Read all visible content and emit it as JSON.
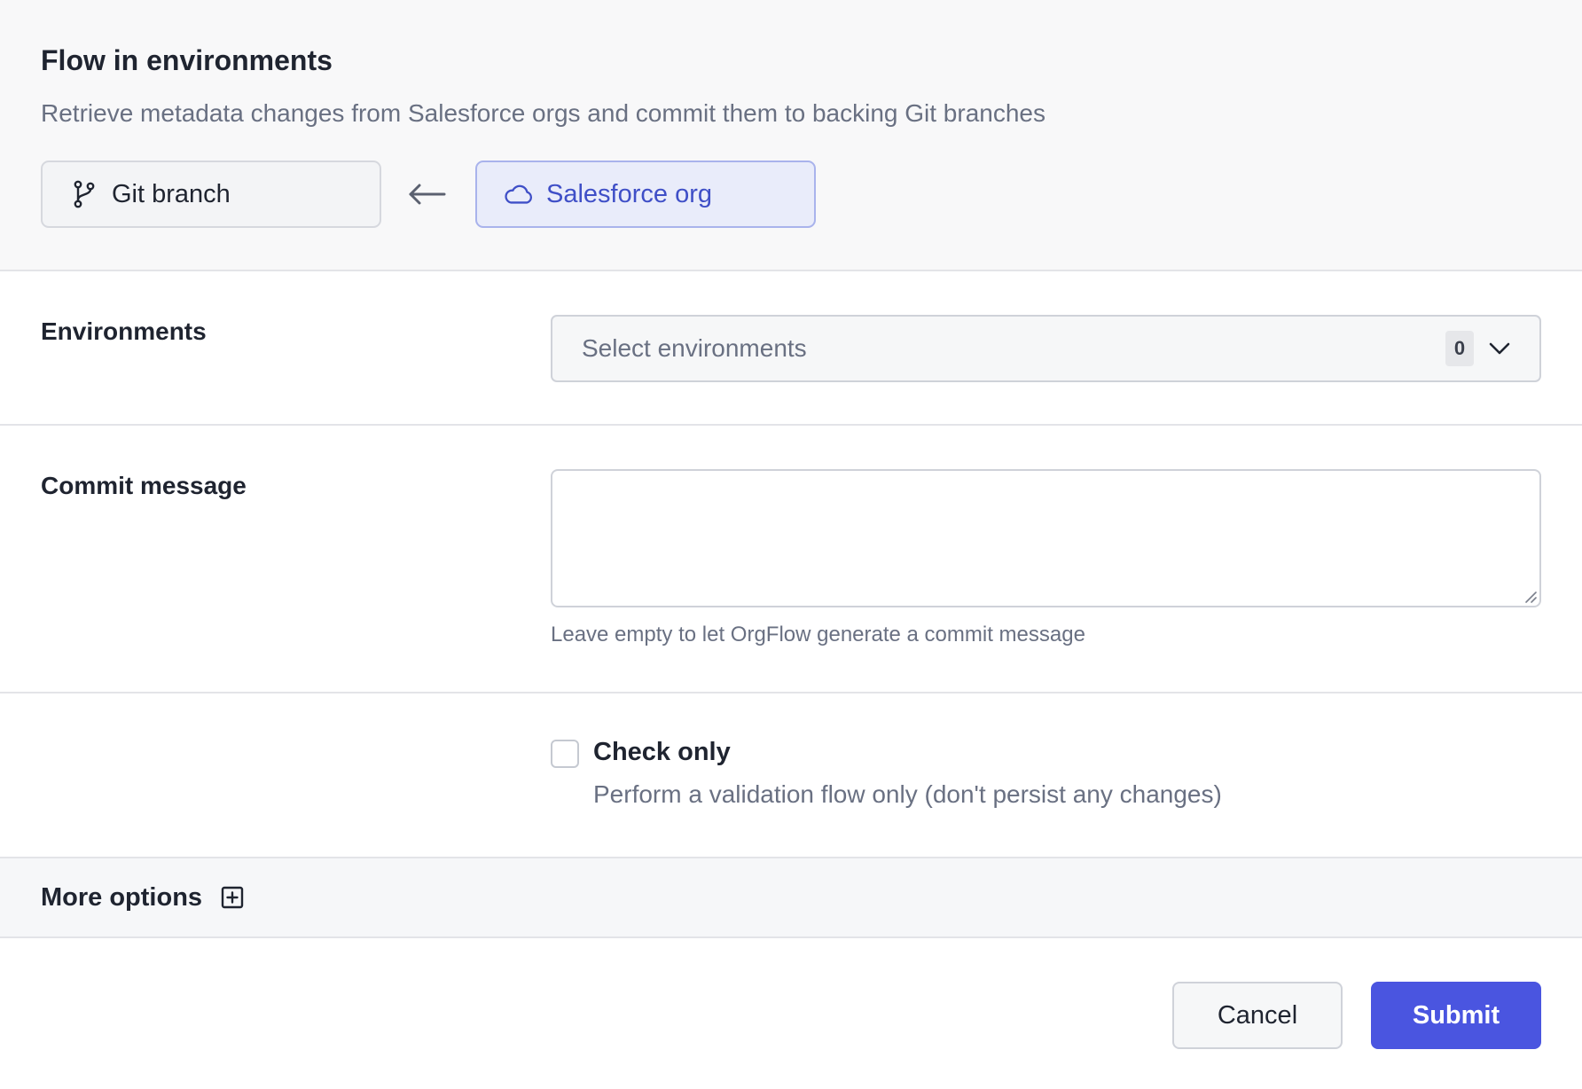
{
  "header": {
    "title": "Flow in environments",
    "subtitle": "Retrieve metadata changes from Salesforce orgs and commit them to backing Git branches",
    "direction": {
      "target_label": "Git branch",
      "target_icon": "git-branch-icon",
      "source_label": "Salesforce org",
      "source_icon": "cloud-icon",
      "arrow_icon": "arrow-left-icon"
    }
  },
  "environments": {
    "label": "Environments",
    "placeholder": "Select environments",
    "count": "0",
    "icon": "chevron-down-icon"
  },
  "commit": {
    "label": "Commit message",
    "value": "",
    "hint": "Leave empty to let OrgFlow generate a commit message"
  },
  "check_only": {
    "label": "Check only",
    "description": "Perform a validation flow only (don't persist any changes)",
    "checked": false
  },
  "more_options": {
    "label": "More options",
    "icon": "plus-square-icon"
  },
  "footer": {
    "cancel_label": "Cancel",
    "submit_label": "Submit"
  },
  "colors": {
    "accent": "#4a55e0",
    "source_bg": "#e9ecfa",
    "source_text": "#3f4fc7",
    "muted_text": "#697082"
  }
}
